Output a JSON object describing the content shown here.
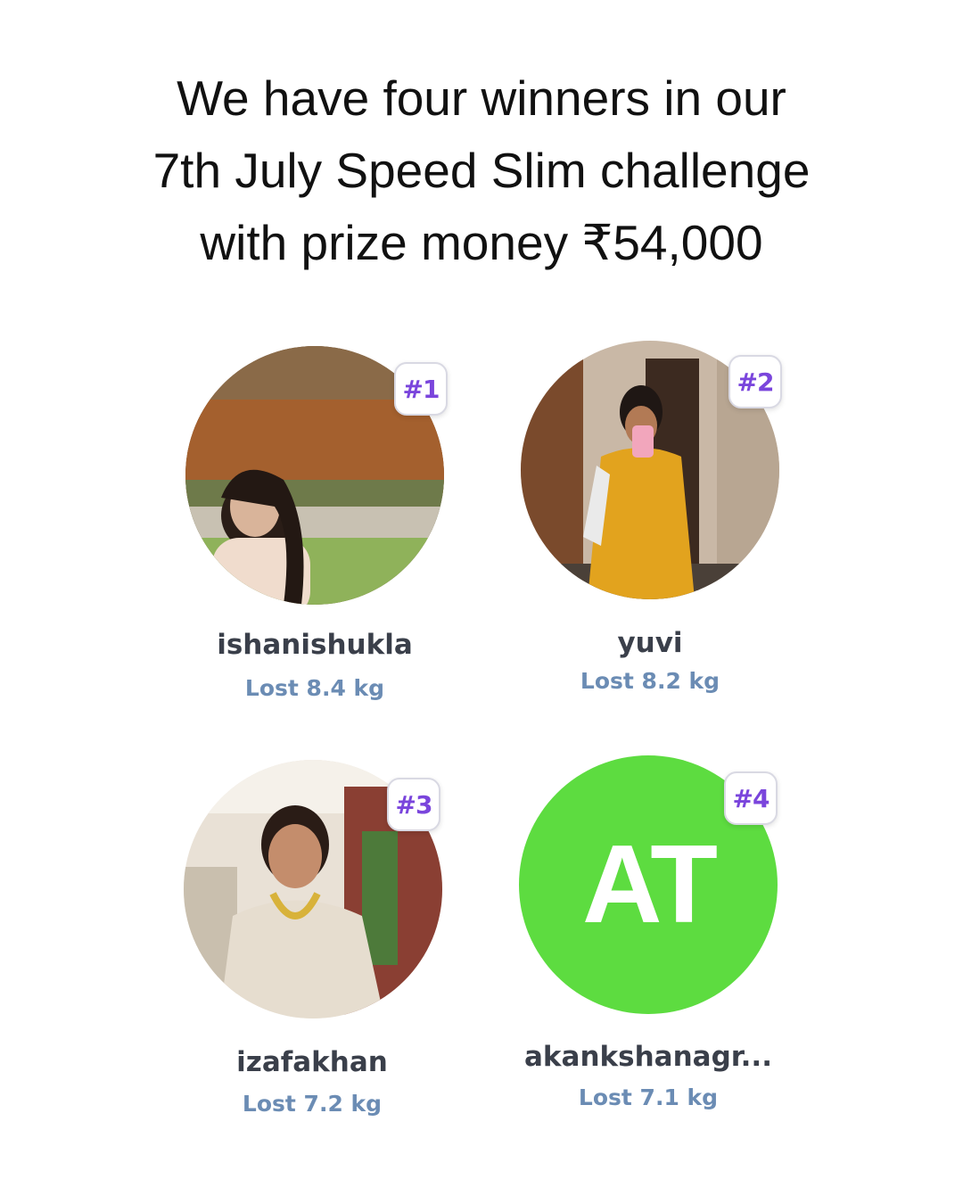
{
  "headline": {
    "line1": "We have four winners in our",
    "line2": "7th July Speed Slim challenge",
    "line3": "with prize money ₹54,000"
  },
  "winners": [
    {
      "rank": "#1",
      "username": "ishanishukla",
      "lost": "Lost 8.4 kg",
      "avatar": "photo"
    },
    {
      "rank": "#2",
      "username": "yuvi",
      "lost": "Lost 8.2 kg",
      "avatar": "photo"
    },
    {
      "rank": "#3",
      "username": "izafakhan",
      "lost": "Lost 7.2 kg",
      "avatar": "photo"
    },
    {
      "rank": "#4",
      "username": "akankshanagr...",
      "lost": "Lost 7.1 kg",
      "avatar": "initials",
      "initials": "AT"
    }
  ],
  "colors": {
    "badge_text": "#7a45dc",
    "lost_text": "#6b8cb4",
    "initials_bg": "#5ddc40"
  }
}
